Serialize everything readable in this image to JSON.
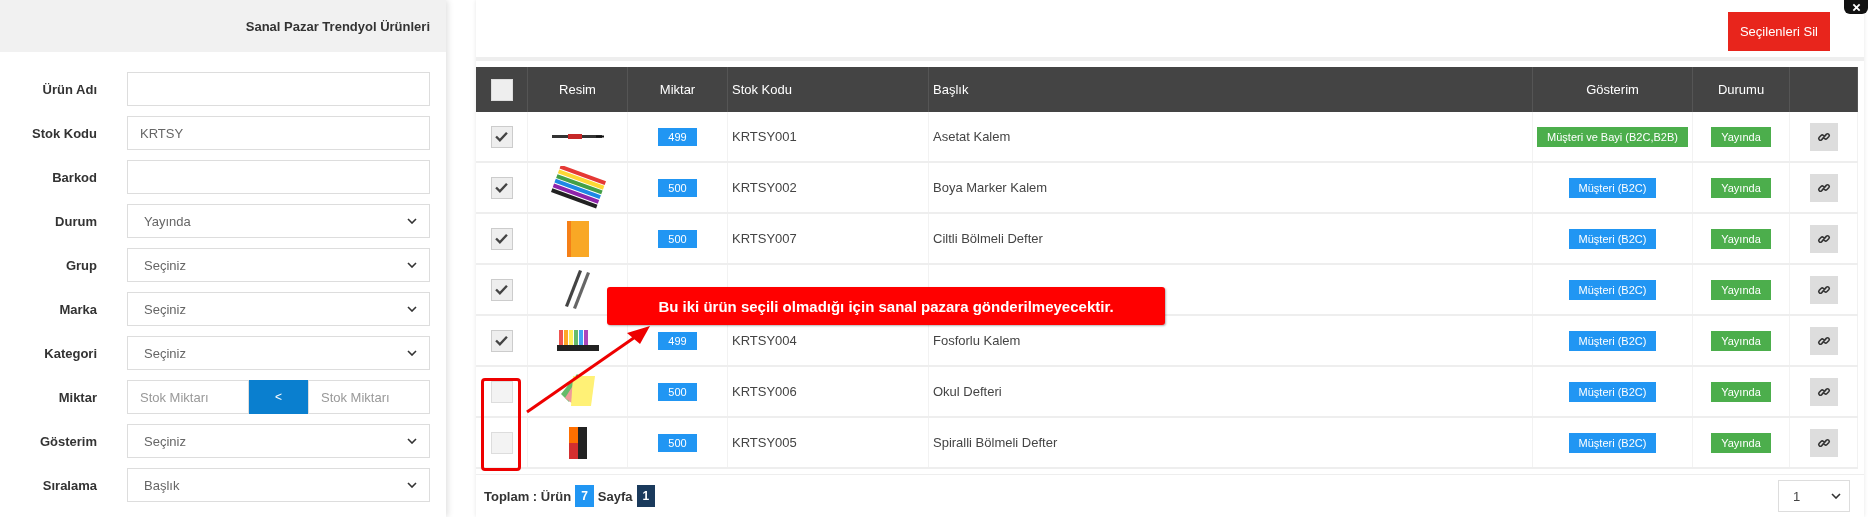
{
  "filter_panel": {
    "title": "Sanal Pazar Trendyol Ürünleri",
    "fields": [
      {
        "label": "Ürün Adı",
        "kind": "text"
      },
      {
        "label": "Stok Kodu",
        "kind": "text",
        "value": "KRTSY"
      },
      {
        "label": "Barkod",
        "kind": "text"
      },
      {
        "label": "Durum",
        "kind": "select",
        "value": "Yayında"
      },
      {
        "label": "Grup",
        "kind": "select",
        "value": "Seçiniz"
      },
      {
        "label": "Marka",
        "kind": "select",
        "value": "Seçiniz"
      },
      {
        "label": "Kategori",
        "kind": "select",
        "value": "Seçiniz"
      },
      {
        "label": "Miktar",
        "kind": "range",
        "placeholder": "Stok Miktarı",
        "button": "<",
        "placeholder_max": "Stok Miktarı"
      },
      {
        "label": "Gösterim",
        "kind": "select",
        "value": "Seçiniz"
      },
      {
        "label": "Sıralama",
        "kind": "select",
        "value": "Başlık"
      }
    ]
  },
  "delete_button": "Seçilenleri Sil",
  "table": {
    "select_all_checked": false,
    "columns": [
      "Resim",
      "Miktar",
      "Stok Kodu",
      "Başlık",
      "Gösterim",
      "Durumu"
    ],
    "rows": [
      {
        "checked": true,
        "quantity": "499",
        "stock_code": "KRTSY001",
        "title": "Asetat Kalem",
        "display": "Müşteri ve Bayi (B2C,B2B)",
        "color": "#4cae4c",
        "status": "Yayında"
      },
      {
        "checked": true,
        "quantity": "500",
        "stock_code": "KRTSY002",
        "title": "Boya Marker Kalem",
        "display": "Müşteri (B2C)",
        "color": "#2196f3",
        "status": "Yayında"
      },
      {
        "checked": true,
        "quantity": "500",
        "stock_code": "KRTSY007",
        "title": "Ciltli Bölmeli Defter",
        "display": "Müşteri (B2C)",
        "color": "#2196f3",
        "status": "Yayında"
      },
      {
        "checked": true,
        "display": "Müşteri (B2C)",
        "color": "#2196f3",
        "status": "Yayında"
      },
      {
        "checked": true,
        "quantity": "499",
        "stock_code": "KRTSY004",
        "title": "Fosforlu Kalem",
        "display": "Müşteri (B2C)",
        "color": "#2196f3",
        "status": "Yayında"
      },
      {
        "checked": false,
        "quantity": "500",
        "stock_code": "KRTSY006",
        "title": "Okul Defteri",
        "display": "Müşteri (B2C)",
        "color": "#2196f3",
        "status": "Yayında"
      },
      {
        "checked": false,
        "quantity": "500",
        "stock_code": "KRTSY005",
        "title": "Spiralli Bölmeli Defter",
        "display": "Müşteri (B2C)",
        "color": "#2196f3",
        "status": "Yayında"
      }
    ]
  },
  "footer": {
    "total_label": "Toplam : Ürün",
    "total": "7",
    "page_label": "Sayfa",
    "page": "1",
    "page_select": "1"
  },
  "callout": "Bu iki ürün seçili olmadığı için sanal pazara gönderilmeyecektir."
}
